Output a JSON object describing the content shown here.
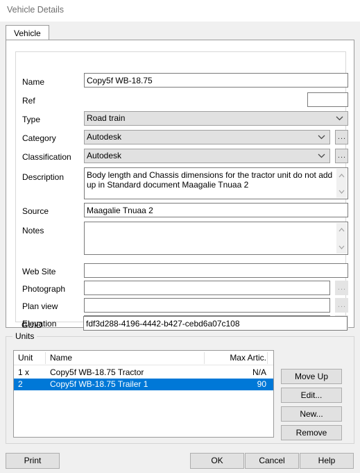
{
  "window": {
    "title": "Vehicle Details"
  },
  "tabs": [
    {
      "label": "Vehicle",
      "active": true
    }
  ],
  "form": {
    "name": {
      "label": "Name",
      "value": "Copy5f WB-18.75"
    },
    "ref": {
      "label": "Ref",
      "value": ""
    },
    "type": {
      "label": "Type",
      "value": "Road train"
    },
    "category": {
      "label": "Category",
      "value": "Autodesk"
    },
    "classification": {
      "label": "Classification",
      "value": "Autodesk"
    },
    "description": {
      "label": "Description",
      "value": "Body length and Chassis dimensions for the tractor unit do not add up in Standard document Maagalie Tnuaa 2"
    },
    "source": {
      "label": "Source",
      "value": "Maagalie Tnuaa 2"
    },
    "notes": {
      "label": "Notes",
      "value": ""
    },
    "web_site": {
      "label": "Web Site",
      "value": ""
    },
    "photograph": {
      "label": "Photograph",
      "value": ""
    },
    "plan_view": {
      "label": "Plan view",
      "value": ""
    },
    "elevation": {
      "label": "Elevation",
      "value": ""
    },
    "guid": {
      "label": "GUID",
      "value": "fdf3d288-4196-4442-b427-cebd6a07c108"
    },
    "browse_label": "..."
  },
  "units": {
    "group_label": "Units",
    "columns": [
      "Unit",
      "Name",
      "Max Artic."
    ],
    "rows": [
      {
        "unit": "1 x",
        "name": "Copy5f WB-18.75 Tractor",
        "max_artic": "N/A",
        "selected": false
      },
      {
        "unit": "2",
        "name": "Copy5f WB-18.75 Trailer 1",
        "max_artic": "90",
        "selected": true
      }
    ],
    "buttons": {
      "move_up": "Move Up",
      "edit": "Edit...",
      "new": "New...",
      "remove": "Remove"
    }
  },
  "footer": {
    "print": "Print",
    "ok": "OK",
    "cancel": "Cancel",
    "help": "Help"
  },
  "colors": {
    "selection": "#0078d7",
    "dialog_bg": "#f0f0f0",
    "control_bg": "#e1e1e1",
    "title_text": "#6e6e6e"
  }
}
